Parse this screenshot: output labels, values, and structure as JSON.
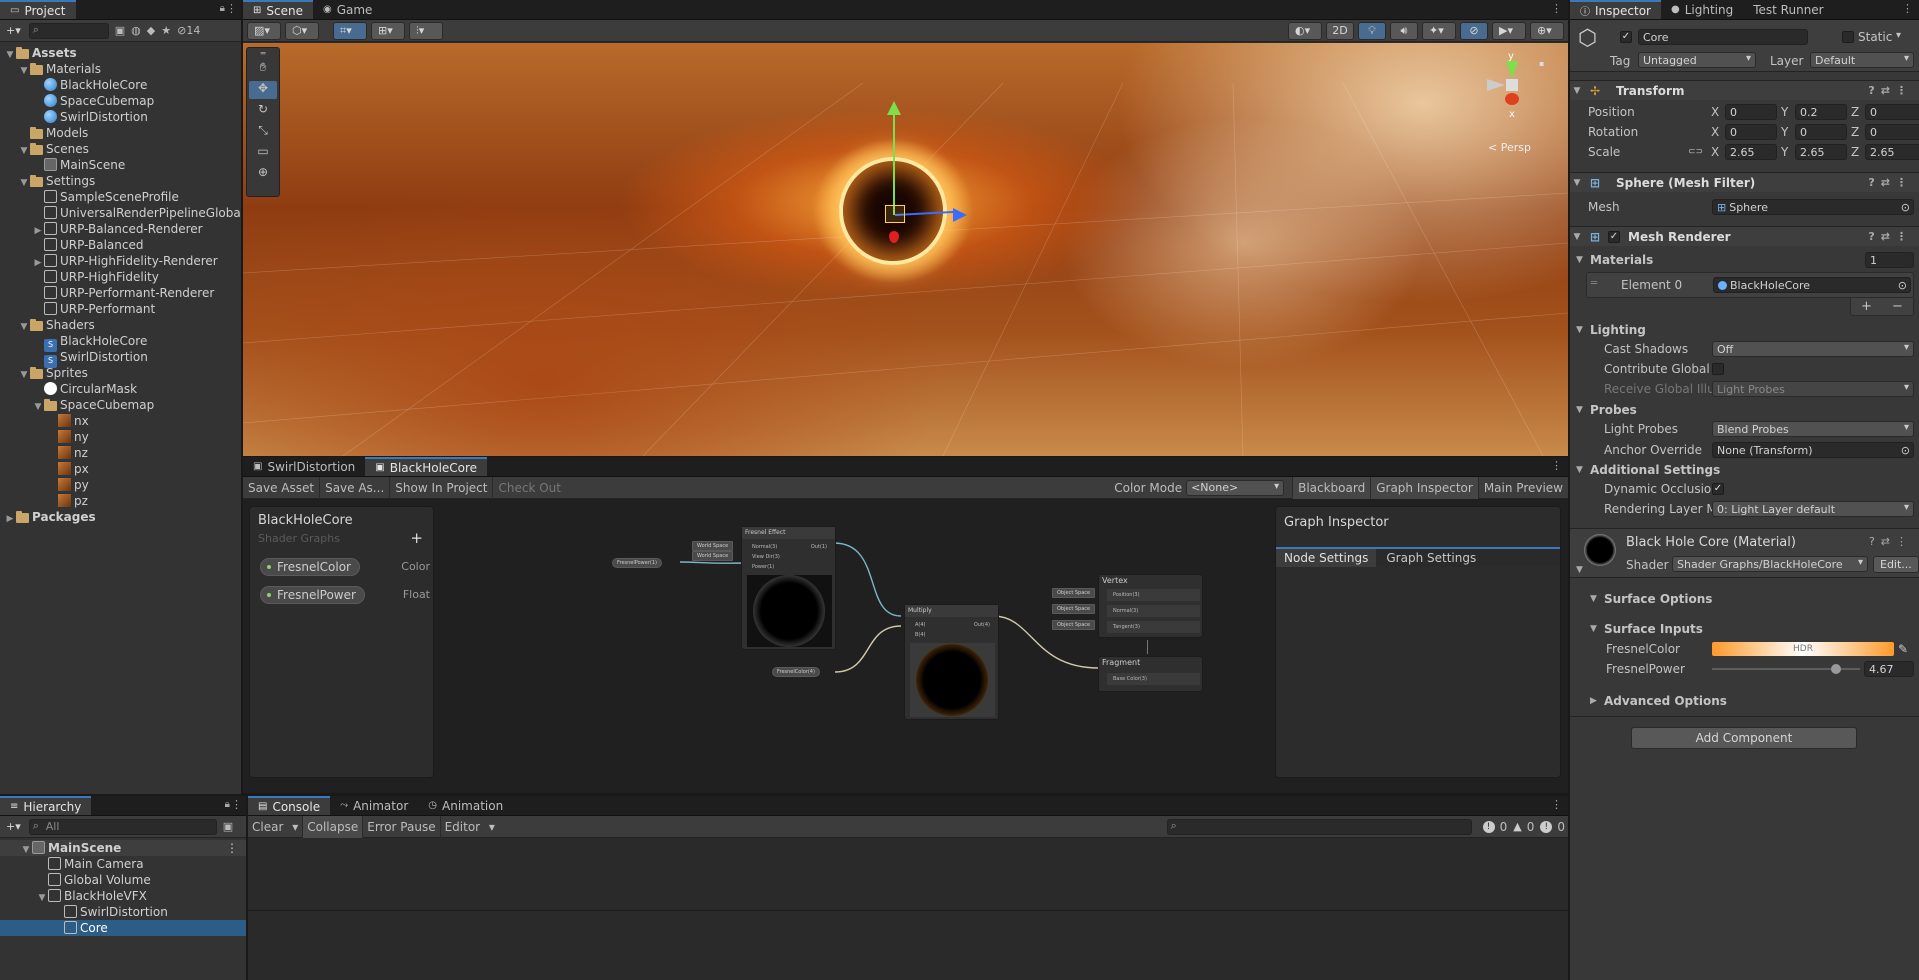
{
  "project": {
    "tab": "Project",
    "add_label": "+",
    "eye_count": "14",
    "tree": [
      {
        "label": "Assets",
        "icon": "folder",
        "depth": 0,
        "arrow": "▼"
      },
      {
        "label": "Materials",
        "icon": "folder",
        "depth": 1,
        "arrow": "▼"
      },
      {
        "label": "BlackHoleCore",
        "icon": "mat",
        "depth": 2,
        "arrow": ""
      },
      {
        "label": "SpaceCubemap",
        "icon": "mat",
        "depth": 2,
        "arrow": ""
      },
      {
        "label": "SwirlDistortion",
        "icon": "mat",
        "depth": 2,
        "arrow": ""
      },
      {
        "label": "Models",
        "icon": "folder",
        "depth": 1,
        "arrow": ""
      },
      {
        "label": "Scenes",
        "icon": "folder",
        "depth": 1,
        "arrow": "▼"
      },
      {
        "label": "MainScene",
        "icon": "unity",
        "depth": 2,
        "arrow": ""
      },
      {
        "label": "Settings",
        "icon": "folder",
        "depth": 1,
        "arrow": "▼"
      },
      {
        "label": "SampleSceneProfile",
        "icon": "cube",
        "depth": 2,
        "arrow": ""
      },
      {
        "label": "UniversalRenderPipelineGlobalS",
        "icon": "cube",
        "depth": 2,
        "arrow": ""
      },
      {
        "label": "URP-Balanced-Renderer",
        "icon": "cube",
        "depth": 2,
        "arrow": "▶"
      },
      {
        "label": "URP-Balanced",
        "icon": "cube",
        "depth": 2,
        "arrow": ""
      },
      {
        "label": "URP-HighFidelity-Renderer",
        "icon": "cube",
        "depth": 2,
        "arrow": "▶"
      },
      {
        "label": "URP-HighFidelity",
        "icon": "cube",
        "depth": 2,
        "arrow": ""
      },
      {
        "label": "URP-Performant-Renderer",
        "icon": "cube",
        "depth": 2,
        "arrow": ""
      },
      {
        "label": "URP-Performant",
        "icon": "cube",
        "depth": 2,
        "arrow": ""
      },
      {
        "label": "Shaders",
        "icon": "folder",
        "depth": 1,
        "arrow": "▼"
      },
      {
        "label": "BlackHoleCore",
        "icon": "shader",
        "depth": 2,
        "arrow": ""
      },
      {
        "label": "SwirlDistortion",
        "icon": "shader",
        "depth": 2,
        "arrow": ""
      },
      {
        "label": "Sprites",
        "icon": "folder",
        "depth": 1,
        "arrow": "▼"
      },
      {
        "label": "CircularMask",
        "icon": "white",
        "depth": 2,
        "arrow": ""
      },
      {
        "label": "SpaceCubemap",
        "icon": "folder",
        "depth": 2,
        "arrow": "▼"
      },
      {
        "label": "nx",
        "icon": "tex",
        "depth": 3,
        "arrow": ""
      },
      {
        "label": "ny",
        "icon": "tex",
        "depth": 3,
        "arrow": ""
      },
      {
        "label": "nz",
        "icon": "tex",
        "depth": 3,
        "arrow": ""
      },
      {
        "label": "px",
        "icon": "tex",
        "depth": 3,
        "arrow": ""
      },
      {
        "label": "py",
        "icon": "tex",
        "depth": 3,
        "arrow": ""
      },
      {
        "label": "pz",
        "icon": "tex",
        "depth": 3,
        "arrow": ""
      },
      {
        "label": "Packages",
        "icon": "folder",
        "depth": 0,
        "arrow": "▶"
      }
    ]
  },
  "hierarchy": {
    "tab": "Hierarchy",
    "search_placeholder": "All",
    "rows": [
      {
        "label": "MainScene",
        "depth": 0,
        "arrow": "▼",
        "icon": "unity",
        "bold": true,
        "selected": false
      },
      {
        "label": "Main Camera",
        "depth": 1,
        "arrow": "",
        "icon": "cube",
        "bold": false,
        "selected": false
      },
      {
        "label": "Global Volume",
        "depth": 1,
        "arrow": "",
        "icon": "cube",
        "bold": false,
        "selected": false
      },
      {
        "label": "BlackHoleVFX",
        "depth": 1,
        "arrow": "▼",
        "icon": "cube",
        "bold": false,
        "selected": false
      },
      {
        "label": "SwirlDistortion",
        "depth": 2,
        "arrow": "",
        "icon": "cube",
        "bold": false,
        "selected": false
      },
      {
        "label": "Core",
        "depth": 2,
        "arrow": "",
        "icon": "cube",
        "bold": false,
        "selected": true
      }
    ]
  },
  "scene": {
    "tabs": [
      "Scene",
      "Game"
    ],
    "mode_2d": "2D",
    "persp_label": "< Persp",
    "gizmo_x": "x",
    "gizmo_y": "y"
  },
  "shader_graph": {
    "tabs": [
      "SwirlDistortion",
      "BlackHoleCore"
    ],
    "toolbar": {
      "save_asset": "Save Asset",
      "save_as": "Save As...",
      "show_in_project": "Show In Project",
      "check_out": "Check Out",
      "color_mode_label": "Color Mode",
      "color_mode_value": "<None>",
      "blackboard": "Blackboard",
      "graph_inspector": "Graph Inspector",
      "main_preview": "Main Preview"
    },
    "blackboard": {
      "title": "BlackHoleCore",
      "subtitle": "Shader Graphs",
      "add": "+",
      "properties": [
        {
          "name": "FresnelColor",
          "type": "Color"
        },
        {
          "name": "FresnelPower",
          "type": "Float"
        }
      ]
    },
    "graph_inspector": {
      "title": "Graph Inspector",
      "tabs": [
        "Node Settings",
        "Graph Settings"
      ]
    },
    "nodes": {
      "fresnel_title": "Fresnel Effect",
      "fresnel_in": [
        "Normal(3)",
        "View Dir(3)",
        "Power(1)"
      ],
      "fresnel_in_src": [
        "World Space",
        "World Space"
      ],
      "fresnel_out": "Out(1)",
      "fresnel_power_pill": "FresnelPower(1)",
      "multiply_title": "Multiply",
      "multiply_in": [
        "A(4)",
        "B(4)"
      ],
      "multiply_out": "Out(4)",
      "fresnel_color_pill": "FresnelColor(4)",
      "vertex_title": "Vertex",
      "vertex_in": [
        "Position(3)",
        "Normal(3)",
        "Tangent(3)"
      ],
      "vertex_src": [
        "Object Space",
        "Object Space",
        "Object Space"
      ],
      "fragment_title": "Fragment",
      "fragment_in": [
        "Base Color(3)"
      ]
    }
  },
  "console": {
    "tabs": [
      "Console",
      "Animator",
      "Animation"
    ],
    "clear": "Clear",
    "collapse": "Collapse",
    "error_pause": "Error Pause",
    "editor": "Editor",
    "count_info": "0",
    "count_warn": "0",
    "count_error": "0"
  },
  "inspector": {
    "tabs": [
      "Inspector",
      "Lighting",
      "Test Runner"
    ],
    "object_name": "Core",
    "static_label": "Static",
    "tag_label": "Tag",
    "tag_value": "Untagged",
    "layer_label": "Layer",
    "layer_value": "Default",
    "transform": {
      "title": "Transform",
      "position_label": "Position",
      "rotation_label": "Rotation",
      "scale_label": "Scale",
      "position": [
        "0",
        "0.2",
        "0"
      ],
      "rotation": [
        "0",
        "0",
        "0"
      ],
      "scale": [
        "2.65",
        "2.65",
        "2.65"
      ],
      "axes": [
        "X",
        "Y",
        "Z"
      ]
    },
    "mesh_filter": {
      "title": "Sphere (Mesh Filter)",
      "mesh_label": "Mesh",
      "mesh_value": "Sphere"
    },
    "mesh_renderer": {
      "title": "Mesh Renderer",
      "materials_label": "Materials",
      "materials_count": "1",
      "element0_label": "Element 0",
      "element0_value": "BlackHoleCore",
      "plus": "+",
      "minus": "−",
      "lighting_label": "Lighting",
      "cast_shadows_label": "Cast Shadows",
      "cast_shadows_value": "Off",
      "contribute_gi_label": "Contribute Global I",
      "receive_gi_label": "Receive Global Illu",
      "receive_gi_value": "Light Probes",
      "probes_label": "Probes",
      "light_probes_label": "Light Probes",
      "light_probes_value": "Blend Probes",
      "anchor_label": "Anchor Override",
      "anchor_value": "None (Transform)",
      "additional_label": "Additional Settings",
      "dynamic_occ_label": "Dynamic Occlusio",
      "rendering_layer_label": "Rendering Layer M",
      "rendering_layer_value": "0: Light Layer default"
    },
    "material": {
      "title": "Black Hole Core (Material)",
      "shader_label": "Shader",
      "shader_value": "Shader Graphs/BlackHoleCore",
      "edit": "Edit...",
      "surface_options": "Surface Options",
      "surface_inputs": "Surface Inputs",
      "fresnel_color_label": "FresnelColor",
      "hdr": "HDR",
      "fresnel_power_label": "FresnelPower",
      "fresnel_power_value": "4.67",
      "fresnel_power_fraction": 0.84,
      "advanced": "Advanced Options"
    },
    "add_component": "Add Component"
  }
}
